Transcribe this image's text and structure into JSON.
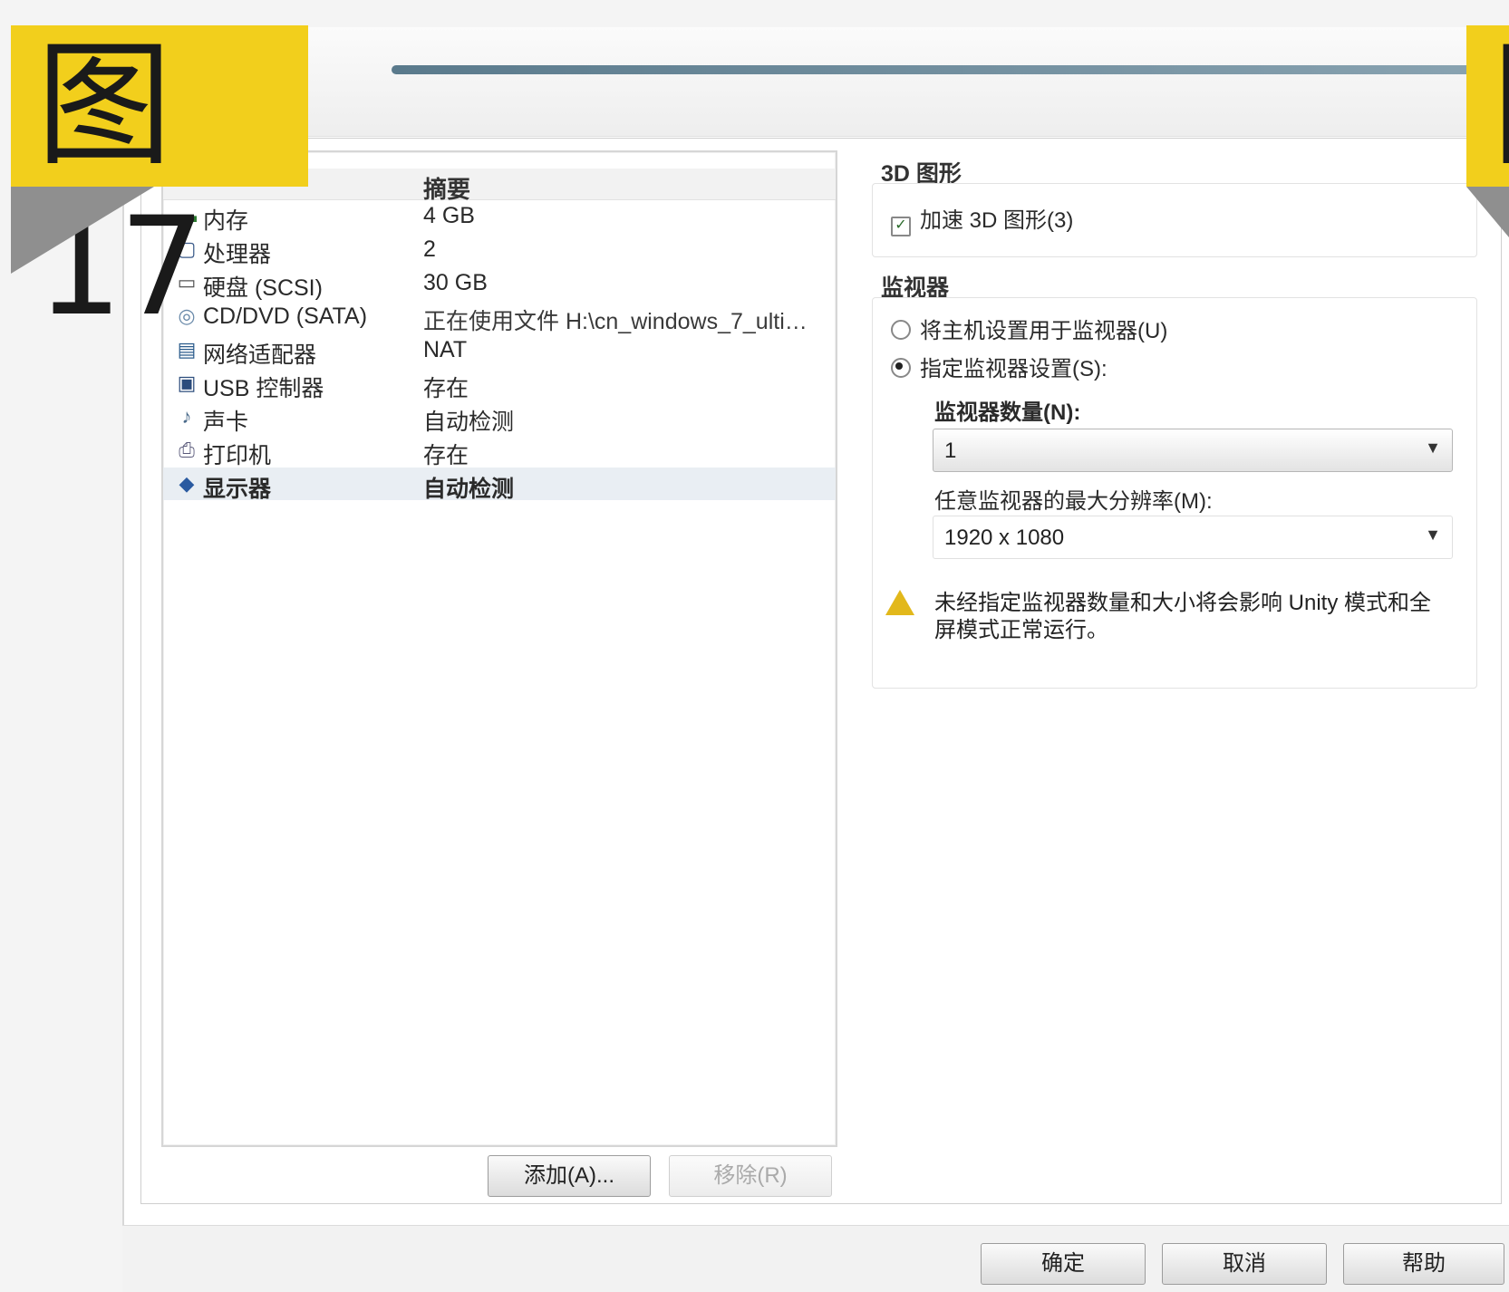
{
  "badge": {
    "text": "图17",
    "partial_text": "图"
  },
  "device_list": {
    "column_header": "摘要",
    "rows": [
      {
        "icon": "memory-icon",
        "name": "内存",
        "value": "4 GB",
        "selected": false
      },
      {
        "icon": "processor-icon",
        "name": "处理器",
        "value": "2",
        "selected": false
      },
      {
        "icon": "hard-disk-icon",
        "name": "硬盘 (SCSI)",
        "value": "30 GB",
        "selected": false
      },
      {
        "icon": "cd-dvd-icon",
        "name": "CD/DVD (SATA)",
        "value": "正在使用文件 H:\\cn_windows_7_ultimate...",
        "selected": false
      },
      {
        "icon": "network-adapter-icon",
        "name": "网络适配器",
        "value": "NAT",
        "selected": false
      },
      {
        "icon": "usb-controller-icon",
        "name": "USB 控制器",
        "value": "存在",
        "selected": false
      },
      {
        "icon": "sound-card-icon",
        "name": "声卡",
        "value": "自动检测",
        "selected": false
      },
      {
        "icon": "printer-icon",
        "name": "打印机",
        "value": "存在",
        "selected": false
      },
      {
        "icon": "display-icon",
        "name": "显示器",
        "value": "自动检测",
        "selected": true
      }
    ],
    "add_button": "添加(A)...",
    "remove_button": "移除(R)"
  },
  "settings": {
    "graphics_3d": {
      "title": "3D 图形",
      "accelerate_label": "加速 3D 图形(3)",
      "accelerate_checked": true
    },
    "monitors": {
      "title": "监视器",
      "use_host_label": "将主机设置用于监视器(U)",
      "specify_label": "指定监视器设置(S):",
      "selected": "specify",
      "count_label": "监视器数量(N):",
      "count_value": "1",
      "max_res_label": "任意监视器的最大分辨率(M):",
      "max_res_value": "1920 x 1080"
    },
    "warning_text": "未经指定监视器数量和大小将会影响 Unity 模式和全屏模式正常运行。",
    "warning_icon": "warning-icon"
  },
  "footer": {
    "ok": "确定",
    "cancel": "取消",
    "help": "帮助"
  },
  "colors": {
    "badge": "#f2cf1c",
    "selected_row": "#e9eef3",
    "warning": "#e2b81b"
  }
}
